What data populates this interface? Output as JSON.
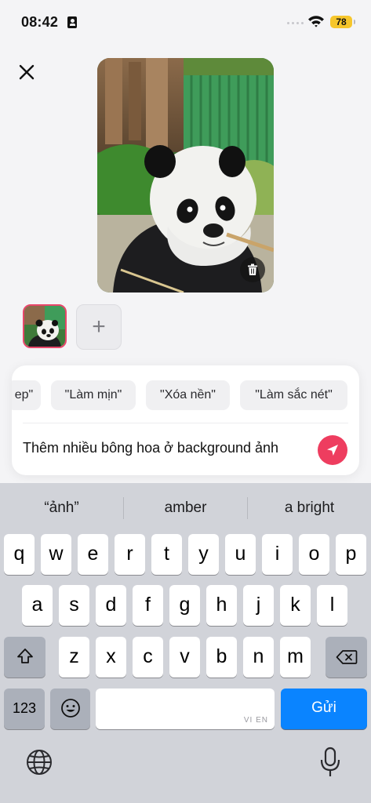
{
  "status": {
    "time": "08:42",
    "battery": "78"
  },
  "suggestions": [
    {
      "label": "ep\""
    },
    {
      "label": "\"Làm mịn\""
    },
    {
      "label": "\"Xóa nền\""
    },
    {
      "label": "\"Làm sắc nét\""
    }
  ],
  "prompt": {
    "text": "Thêm nhiều bông hoa ở background ảnh"
  },
  "keyboard": {
    "predictions": [
      "“ảnh”",
      "amber",
      "a bright"
    ],
    "row1": [
      "q",
      "w",
      "e",
      "r",
      "t",
      "y",
      "u",
      "i",
      "o",
      "p"
    ],
    "row2": [
      "a",
      "s",
      "d",
      "f",
      "g",
      "h",
      "j",
      "k",
      "l"
    ],
    "row3": [
      "z",
      "x",
      "c",
      "v",
      "b",
      "n",
      "m"
    ],
    "numbers_key": "123",
    "space_lang": "VI EN",
    "send_key": "Gửi"
  },
  "colors": {
    "accent_pink": "#ee3d5f",
    "send_blue": "#0a84ff",
    "battery": "#f6c62c"
  }
}
